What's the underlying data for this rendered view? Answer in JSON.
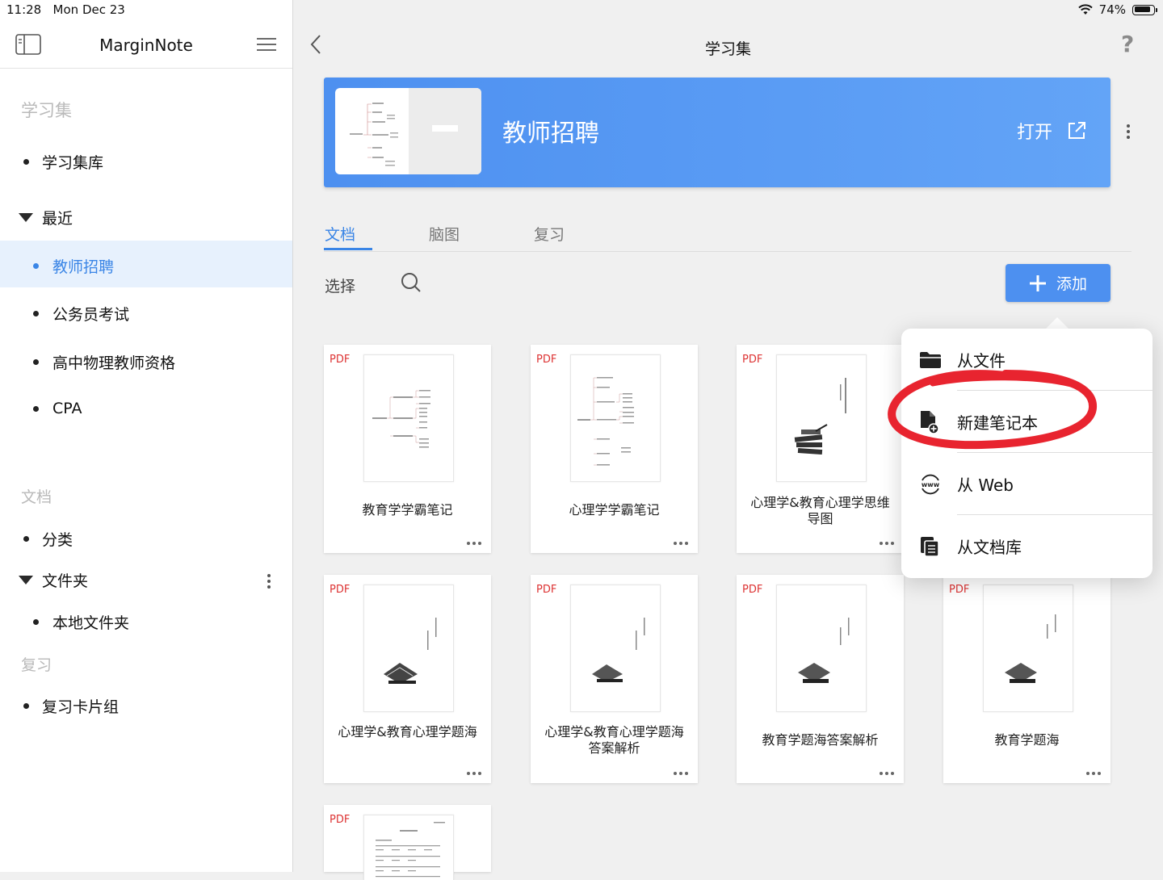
{
  "status": {
    "time": "11:28",
    "date": "Mon Dec 23",
    "battery": "74%"
  },
  "sidebar": {
    "title": "MarginNote",
    "sections": {
      "study_sets": "学习集",
      "documents": "文档",
      "review": "复习"
    },
    "library": "学习集库",
    "recent": "最近",
    "recent_items": [
      "教师招聘",
      "公务员考试",
      "高中物理教师资格",
      "CPA"
    ],
    "categories": "分类",
    "folders": "文件夹",
    "local_folder": "本地文件夹",
    "review_cards": "复习卡片组"
  },
  "header": {
    "title": "学习集",
    "help": "?"
  },
  "banner": {
    "title": "教师招聘",
    "open_label": "打开"
  },
  "tabs": [
    "文档",
    "脑图",
    "复习"
  ],
  "toolbar": {
    "select_label": "选择",
    "add_label": "添加"
  },
  "documents": [
    {
      "type": "PDF",
      "name": "教育学学霸笔记",
      "thumb": "mindmap"
    },
    {
      "type": "PDF",
      "name": "心理学学霸笔记",
      "thumb": "mindmap2"
    },
    {
      "type": "PDF",
      "name": "心理学&教育心理学思维导图",
      "thumb": "books"
    },
    {
      "type": "PDF",
      "name": "心理学&教育心理学题海",
      "thumb": "book"
    },
    {
      "type": "PDF",
      "name": "心理学&教育心理学题海答案解析",
      "thumb": "book"
    },
    {
      "type": "PDF",
      "name": "教育学题海答案解析",
      "thumb": "book"
    },
    {
      "type": "PDF",
      "name": "教育学题海",
      "thumb": "book"
    },
    {
      "type": "PDF",
      "name": "",
      "thumb": "text"
    }
  ],
  "add_menu": [
    {
      "label": "从文件",
      "icon": "folder-icon"
    },
    {
      "label": "新建笔记本",
      "icon": "new-notebook-icon"
    },
    {
      "label": "从 Web",
      "icon": "www-icon"
    },
    {
      "label": "从文档库",
      "icon": "library-icon"
    }
  ],
  "colors": {
    "accent": "#3a85e6",
    "banner": "#4d90f0",
    "highlight_circle": "#e8242f",
    "pdf_label": "#dd3333"
  }
}
